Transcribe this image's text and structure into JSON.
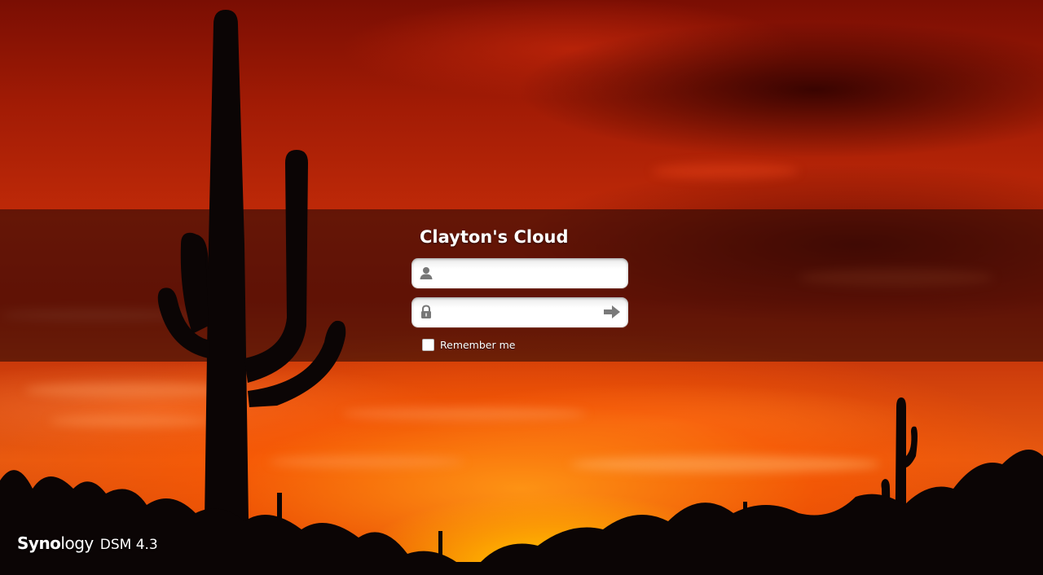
{
  "login": {
    "server_name": "Clayton's Cloud",
    "username_placeholder": "",
    "password_placeholder": "",
    "remember_label": "Remember me",
    "remember_checked": false
  },
  "branding": {
    "logo_bold": "Syno",
    "logo_regular": "logy",
    "product": "DSM 4.3"
  },
  "icons": {
    "username": "user-icon",
    "password": "lock-icon",
    "submit": "arrow-right-icon"
  },
  "colors": {
    "sky_top": "#7a0e03",
    "sky_mid": "#c02a08",
    "sunset_glow": "#ffb000",
    "band_overlay": "#190505",
    "text": "#ffffff"
  }
}
